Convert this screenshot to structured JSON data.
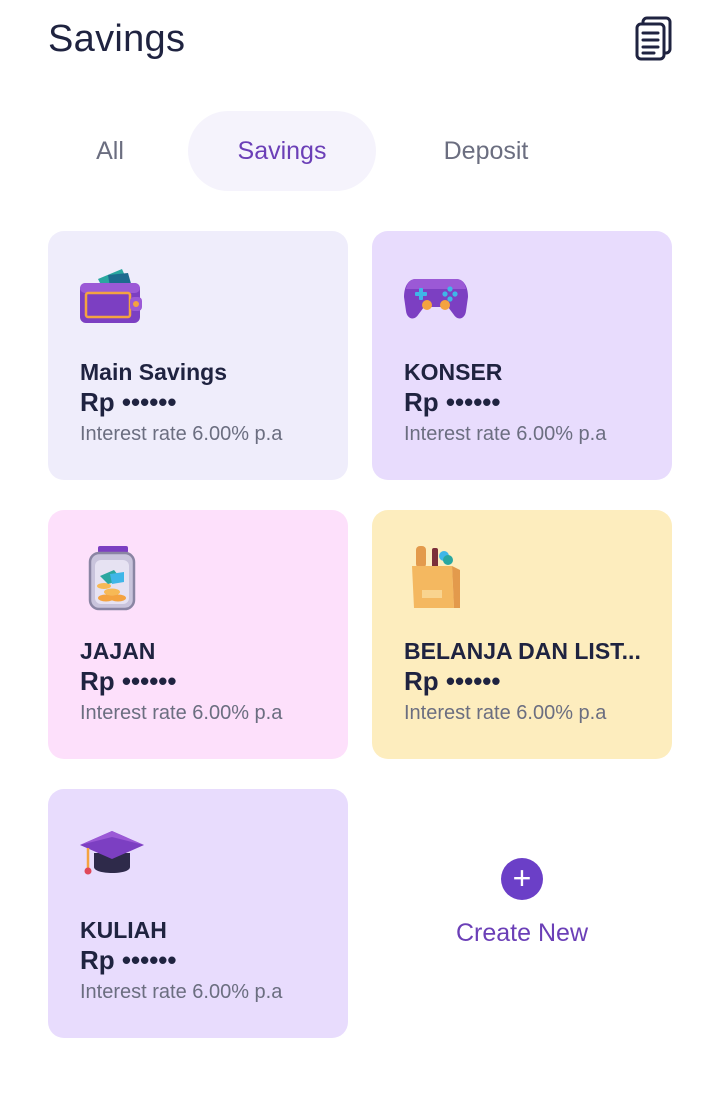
{
  "header": {
    "title": "Savings",
    "doc_icon": "document-list-icon"
  },
  "tabs": [
    {
      "label": "All",
      "active": false
    },
    {
      "label": "Savings",
      "active": true
    },
    {
      "label": "Deposit",
      "active": false
    }
  ],
  "cards": [
    {
      "name": "Main Savings",
      "amount": "Rp ••••••",
      "rate": "Interest rate 6.00% p.a",
      "icon": "wallet-icon",
      "color": "#efedfb"
    },
    {
      "name": "KONSER",
      "amount": "Rp ••••••",
      "rate": "Interest rate 6.00% p.a",
      "icon": "gamepad-icon",
      "color": "#e8dcfd"
    },
    {
      "name": "JAJAN",
      "amount": "Rp ••••••",
      "rate": "Interest rate 6.00% p.a",
      "icon": "coin-jar-icon",
      "color": "#fde0fb"
    },
    {
      "name": "BELANJA DAN LIST...",
      "amount": "Rp ••••••",
      "rate": "Interest rate 6.00% p.a",
      "icon": "grocery-bag-icon",
      "color": "#fdedbe"
    },
    {
      "name": "KULIAH",
      "amount": "Rp ••••••",
      "rate": "Interest rate 6.00% p.a",
      "icon": "graduation-cap-icon",
      "color": "#e8dcfd"
    }
  ],
  "create_new": {
    "label": "Create New",
    "icon": "plus-icon",
    "symbol": "+"
  },
  "colors": {
    "accent": "#6b3fb7",
    "text_dark": "#1f2340",
    "text_muted": "#6b6e80"
  }
}
